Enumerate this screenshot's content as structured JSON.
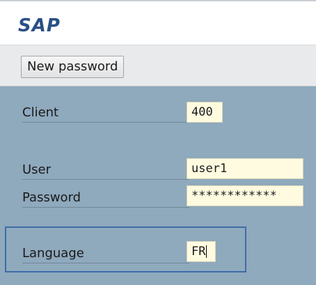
{
  "header": {
    "title": "SAP"
  },
  "toolbar": {
    "new_password_label": "New password"
  },
  "form": {
    "client": {
      "label": "Client",
      "value": "400"
    },
    "user": {
      "label": "User",
      "value": "user1"
    },
    "password": {
      "label": "Password",
      "value": "************"
    },
    "language": {
      "label": "Language",
      "value": "FR"
    }
  },
  "colors": {
    "brand": "#2a4f86",
    "form_background": "#8fa9bd",
    "input_background": "#fffbe0",
    "focus_frame": "#3f6da8"
  }
}
